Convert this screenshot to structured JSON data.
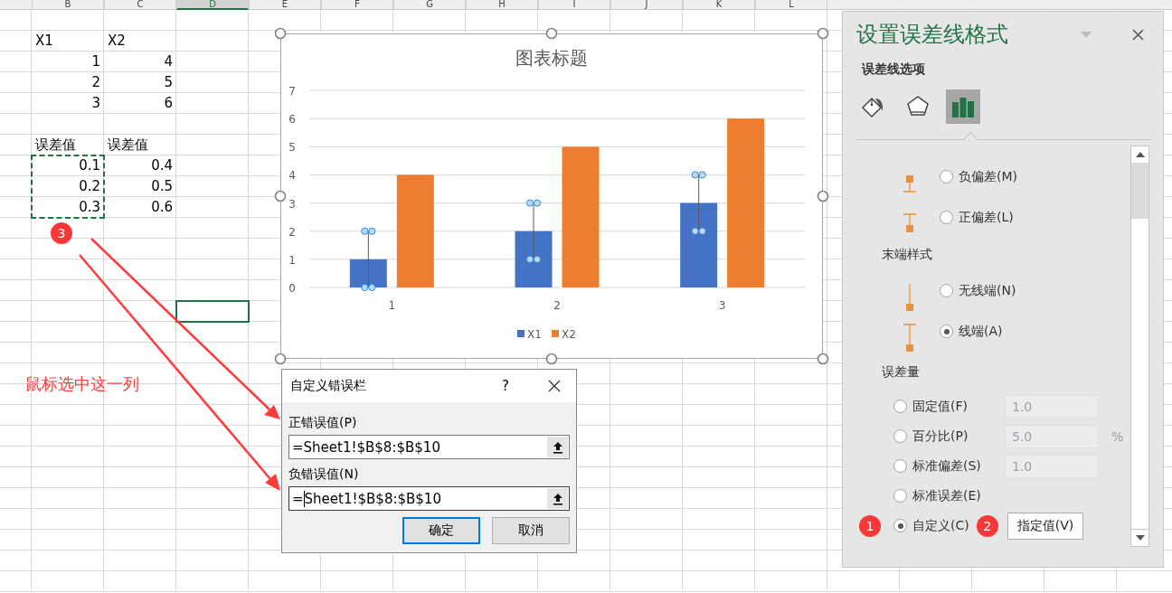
{
  "sheet": {
    "column_headers": [
      {
        "label": "B",
        "selected": false
      },
      {
        "label": "C",
        "selected": false
      },
      {
        "label": "D",
        "selected": true
      },
      {
        "label": "E",
        "selected": false
      },
      {
        "label": "F",
        "selected": false
      },
      {
        "label": "G",
        "selected": false
      },
      {
        "label": "H",
        "selected": false
      },
      {
        "label": "I",
        "selected": false
      },
      {
        "label": "J",
        "selected": false
      },
      {
        "label": "K",
        "selected": false
      },
      {
        "label": "L",
        "selected": false
      }
    ],
    "table_1": {
      "header": [
        "X1",
        "X2"
      ],
      "rows": [
        [
          "1",
          "4"
        ],
        [
          "2",
          "5"
        ],
        [
          "3",
          "6"
        ]
      ]
    },
    "table_2": {
      "header": [
        "误差值",
        "误差值"
      ],
      "rows": [
        [
          "0.1",
          "0.4"
        ],
        [
          "0.2",
          "0.5"
        ],
        [
          "0.3",
          "0.6"
        ]
      ]
    }
  },
  "chart": {
    "chart_data": {
      "type": "bar",
      "title": "图表标题",
      "categories": [
        "1",
        "2",
        "3"
      ],
      "series": [
        {
          "name": "X1",
          "color": "#4472c4",
          "values": [
            1,
            2,
            3
          ]
        },
        {
          "name": "X2",
          "color": "#ed7d31",
          "values": [
            4,
            5,
            6
          ]
        }
      ],
      "ylim": [
        0,
        7
      ],
      "yticks": [
        0,
        1,
        2,
        3,
        4,
        5,
        6,
        7
      ],
      "grid": true,
      "legend": true
    }
  },
  "annotations": {
    "badge": "3",
    "note": "鼠标选中这一列"
  },
  "dialog": {
    "title": "自定义错误栏",
    "help": "?",
    "fields": [
      {
        "label": "正错误值(P)",
        "value": "=Sheet1!$B$8:$B$10",
        "focused": false
      },
      {
        "label": "负错误值(N)",
        "value": "=Sheet1!$B$8:$B$10",
        "focused": true
      }
    ],
    "buttons": [
      {
        "label": "确定",
        "default": true
      },
      {
        "label": "取消",
        "default": false
      }
    ]
  },
  "panel": {
    "title": "设置误差线格式",
    "subtitle": "误差线选项",
    "tabs": [
      {
        "kind": "fill",
        "selected": false
      },
      {
        "kind": "shape",
        "selected": false
      },
      {
        "kind": "options",
        "selected": true
      }
    ],
    "direction_options": [
      {
        "kind": "minus",
        "label": "负偏差(M)",
        "selected": false
      },
      {
        "kind": "plus",
        "label": "正偏差(L)",
        "selected": false
      }
    ],
    "end_style": {
      "heading": "末端样式",
      "options": [
        {
          "kind": "no_cap",
          "label": "无线端(N)",
          "selected": false
        },
        {
          "kind": "cap",
          "label": "线端(A)",
          "selected": true
        }
      ]
    },
    "error_amount": {
      "heading": "误差量",
      "options": [
        {
          "label": "固定值(F)",
          "selected": false,
          "value": "1.0",
          "disabled": true
        },
        {
          "label": "百分比(P)",
          "selected": false,
          "value": "5.0",
          "unit": "%",
          "disabled": true
        },
        {
          "label": "标准偏差(S)",
          "selected": false,
          "value": "1.0",
          "disabled": true
        },
        {
          "label": "标准误差(E)",
          "selected": false
        },
        {
          "label": "自定义(C)",
          "selected": true,
          "marker": "1",
          "button_marker": "2",
          "button": "指定值(V)"
        }
      ]
    }
  }
}
